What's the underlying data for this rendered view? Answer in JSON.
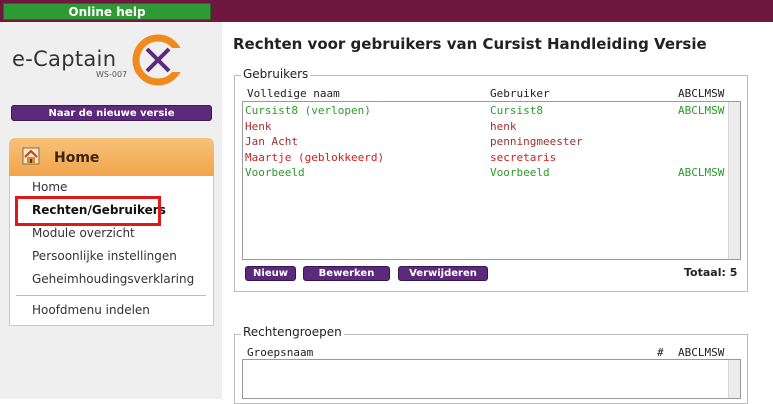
{
  "topbar": {
    "online_help": "Online help"
  },
  "logo": {
    "name": "e-Captain",
    "sub": "WS-007"
  },
  "sidebar": {
    "new_version": "Naar de nieuwe versie",
    "section_title": "Home",
    "items": [
      "Home",
      "Rechten/Gebruikers",
      "Module overzicht",
      "Persoonlijke instellingen",
      "Geheimhoudingsverklaring"
    ],
    "extra_item": "Hoofdmenu indelen"
  },
  "main": {
    "title": "Rechten voor gebruikers van Cursist Handleiding Versie",
    "users": {
      "legend": "Gebruikers",
      "col_name": "Volledige naam",
      "col_user": "Gebruiker",
      "col_rights": "ABCLMSW",
      "rows": [
        {
          "name": "Cursist8 (verlopen)",
          "user": "Cursist8",
          "rights": "ABCLMSW",
          "color": "#2a9a2a"
        },
        {
          "name": "Henk",
          "user": "henk",
          "rights": "",
          "color": "#a03030"
        },
        {
          "name": "Jan Acht",
          "user": "penningmeester",
          "rights": "",
          "color": "#a03030"
        },
        {
          "name": "Maartje (geblokkeerd)",
          "user": "secretaris",
          "rights": "",
          "color": "#cc2020"
        },
        {
          "name": "Voorbeeld",
          "user": "Voorbeeld",
          "rights": "ABCLMSW",
          "color": "#2a9a2a"
        }
      ],
      "btn_new": "Nieuw",
      "btn_edit": "Bewerken",
      "btn_delete": "Verwijderen",
      "total": "Totaal: 5"
    },
    "groups": {
      "legend": "Rechtengroepen",
      "col_name": "Groepsnaam",
      "col_count": "#",
      "col_rights": "ABCLMSW"
    }
  }
}
